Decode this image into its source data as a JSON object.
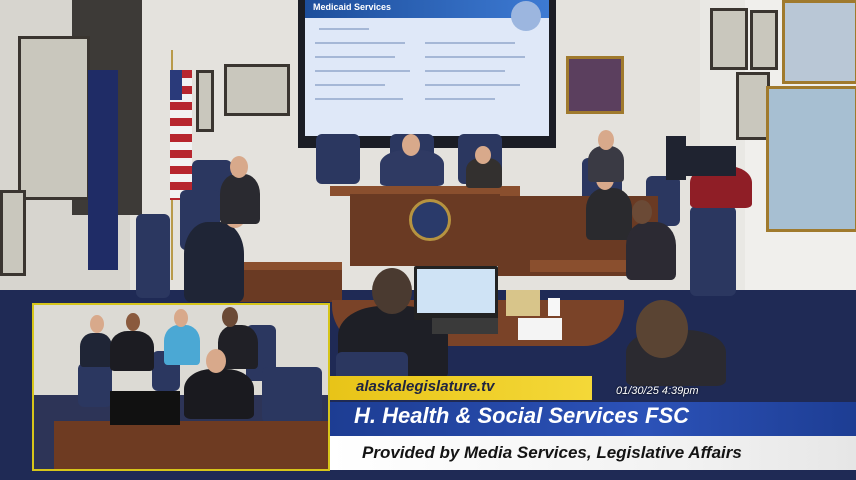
{
  "presentation": {
    "slide_title": "Medicaid Services"
  },
  "overlay": {
    "website": "alaskalegislature.tv",
    "timestamp": "01/30/25 4:39pm",
    "committee_title": "H. Health & Social Services FSC",
    "credit": "Provided by Media Services, Legislative Affairs"
  },
  "colors": {
    "url_strip": "#e8c418",
    "title_strip": "#1d3d93",
    "credit_strip": "#ffffff",
    "pip_border": "#d6c51a"
  }
}
